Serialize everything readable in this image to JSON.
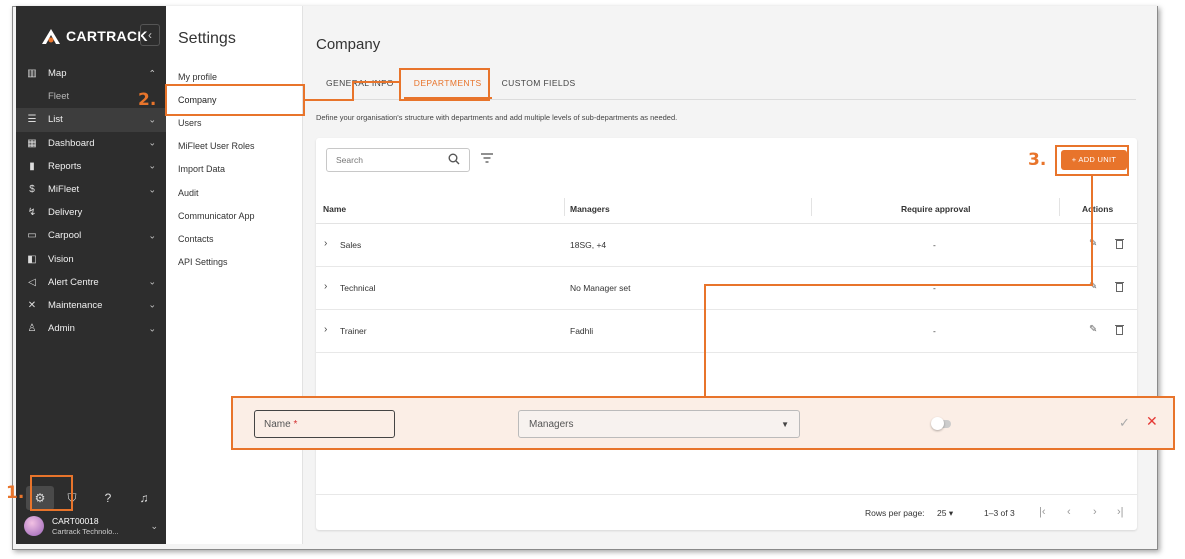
{
  "app": {
    "logo_text": "CARTRACK",
    "collapse_icon": "‹"
  },
  "sidebar": {
    "items": [
      {
        "label": "Map",
        "icon": "map-icon",
        "chevron": "⌃"
      },
      {
        "label": "Fleet",
        "sub": true
      },
      {
        "label": "List",
        "icon": "list-icon",
        "chevron": "⌄",
        "active": true
      },
      {
        "label": "Dashboard",
        "icon": "dashboard-icon",
        "chevron": "⌄"
      },
      {
        "label": "Reports",
        "icon": "reports-icon",
        "chevron": "⌄"
      },
      {
        "label": "MiFleet",
        "icon": "dollar-icon",
        "chevron": "⌄"
      },
      {
        "label": "Delivery",
        "icon": "delivery-icon"
      },
      {
        "label": "Carpool",
        "icon": "calendar-icon",
        "chevron": "⌄"
      },
      {
        "label": "Vision",
        "icon": "vision-icon"
      },
      {
        "label": "Alert Centre",
        "icon": "alert-icon",
        "chevron": "⌄"
      },
      {
        "label": "Maintenance",
        "icon": "tools-icon",
        "chevron": "⌄"
      },
      {
        "label": "Admin",
        "icon": "admin-icon",
        "chevron": "⌄"
      }
    ],
    "bottom_icons": [
      "gear-icon",
      "shield-icon",
      "help-icon",
      "bell-icon"
    ],
    "user": {
      "name": "CART00018",
      "org": "Cartrack Technolo..."
    }
  },
  "settings": {
    "title": "Settings",
    "items": [
      "My profile",
      "Company",
      "Users",
      "MiFleet User Roles",
      "Import Data",
      "Audit",
      "Communicator App",
      "Contacts",
      "API Settings"
    ]
  },
  "main": {
    "title": "Company",
    "tabs": [
      "GENERAL INFO",
      "DEPARTMENTS",
      "CUSTOM FIELDS"
    ],
    "active_tab": "DEPARTMENTS",
    "description": "Define your organisation's structure with departments and add multiple levels of sub-departments as needed.",
    "search_placeholder": "Search",
    "add_button": "+ ADD UNIT",
    "columns": [
      "Name",
      "Managers",
      "Require approval",
      "Actions"
    ],
    "rows": [
      {
        "name": "Sales",
        "managers": "18SG, +4",
        "approval": "-"
      },
      {
        "name": "Technical",
        "managers": "No Manager set",
        "approval": "-"
      },
      {
        "name": "Trainer",
        "managers": "Fadhli",
        "approval": "-"
      }
    ],
    "footer": {
      "rows_per_page_label": "Rows per page:",
      "rows_per_page": "25",
      "range": "1–3 of 3"
    }
  },
  "edit_row": {
    "name_placeholder": "Name",
    "required_mark": "*",
    "managers_placeholder": "Managers"
  },
  "callouts": [
    "1.",
    "2.",
    "3."
  ],
  "colors": {
    "accent": "#e8742b",
    "sidebar_bg": "#2d2d2d",
    "danger": "#e53935"
  }
}
